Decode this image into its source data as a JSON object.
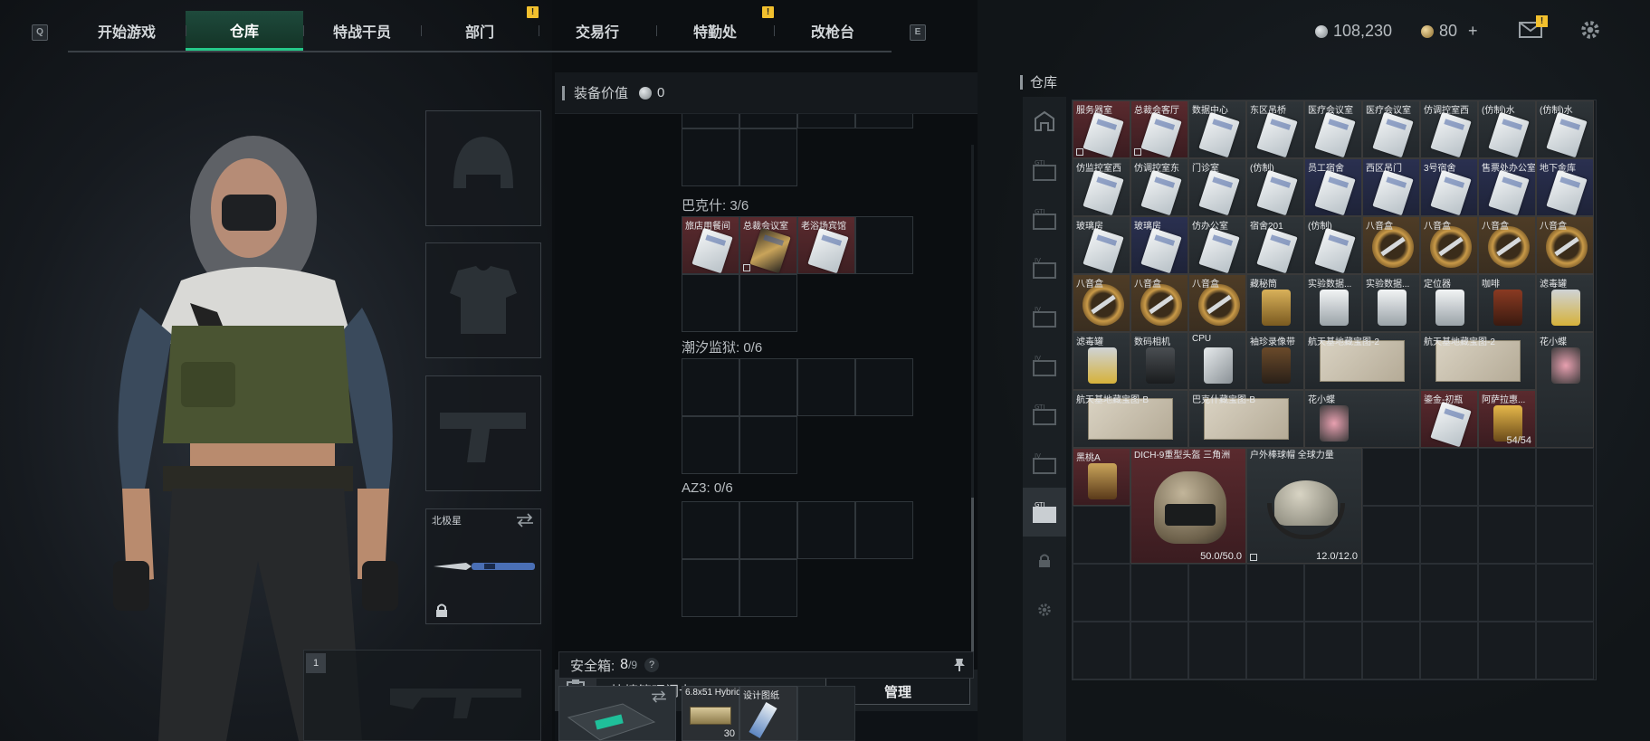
{
  "nav": {
    "q_key": "Q",
    "e_key": "E",
    "tabs": [
      {
        "label": "开始游戏",
        "active": false,
        "alert": false
      },
      {
        "label": "仓库",
        "active": true,
        "alert": false
      },
      {
        "label": "特战干员",
        "active": false,
        "alert": false
      },
      {
        "label": "部门",
        "active": false,
        "alert": true
      },
      {
        "label": "交易行",
        "active": false,
        "alert": false
      },
      {
        "label": "特勤处",
        "active": false,
        "alert": true
      },
      {
        "label": "改枪台",
        "active": false,
        "alert": false
      }
    ],
    "alert_glyph": "!"
  },
  "currency": {
    "silver": "108,230",
    "gold": "80",
    "plus": "+",
    "mail_alert": "!"
  },
  "equipment": {
    "melee_label": "北极星",
    "weapon_slot_number": "1"
  },
  "middle": {
    "value_label": "装备价值",
    "value": "0",
    "sections": [
      {
        "title": "巴克什: 3/6"
      },
      {
        "title": "潮汐监狱: 0/6"
      },
      {
        "title": "AZ3: 0/6"
      }
    ],
    "bakesh_keys": [
      "旅店用餐间",
      "总裁会议室",
      "老浴场宾馆"
    ],
    "quick_manage_label": "快捷管理门卡",
    "manage_button": "管理",
    "safe_box_label": "安全箱:",
    "safe_box_count": "8",
    "safe_box_max": "/9",
    "safe_help": "?",
    "safe_items": [
      {
        "label": "6.8x51 Hybrid",
        "count": "30"
      },
      {
        "label": "设计图纸",
        "count": ""
      }
    ]
  },
  "warehouse": {
    "title": "仓库",
    "items": [
      {
        "label": "服务器室",
        "style": "red"
      },
      {
        "label": "总裁会客厅",
        "style": "red"
      },
      {
        "label": "数据中心",
        "style": "dark"
      },
      {
        "label": "东区吊桥",
        "style": "dark"
      },
      {
        "label": "医疗会议室",
        "style": "dark"
      },
      {
        "label": "医疗会议室",
        "style": "dark"
      },
      {
        "label": "仿调控室西",
        "style": "dark"
      },
      {
        "label": "(仿制)水",
        "style": "dark"
      },
      {
        "label": "(仿制)水",
        "style": "dark"
      },
      {
        "label": "仿监控室西",
        "style": "dark"
      },
      {
        "label": "仿调控室东",
        "style": "dark"
      },
      {
        "label": "门诊室",
        "style": "dark"
      },
      {
        "label": "(仿制)",
        "style": "dark"
      },
      {
        "label": "员工宿舍",
        "style": "blue"
      },
      {
        "label": "西区吊门",
        "style": "blue"
      },
      {
        "label": "3号宿舍",
        "style": "blue"
      },
      {
        "label": "售票处办公室",
        "style": "blue"
      },
      {
        "label": "地下金库",
        "style": "blue"
      },
      {
        "label": "玻璃房",
        "style": "dark"
      },
      {
        "label": "玻璃房",
        "style": "blue"
      },
      {
        "label": "仿办公室",
        "style": "dark"
      },
      {
        "label": "宿舍201",
        "style": "dark"
      },
      {
        "label": "(仿制)",
        "style": "dark"
      },
      {
        "label": "八音盒",
        "style": "gold"
      },
      {
        "label": "八音盒",
        "style": "gold"
      },
      {
        "label": "八音盒",
        "style": "gold"
      },
      {
        "label": "八音盒",
        "style": "gold"
      },
      {
        "label": "八音盒",
        "style": "gold"
      },
      {
        "label": "八音盒",
        "style": "gold"
      },
      {
        "label": "八音盒",
        "style": "gold"
      },
      {
        "label": "藏秘筒",
        "style": "dark"
      },
      {
        "label": "实验数据...",
        "style": "dark"
      },
      {
        "label": "实验数据...",
        "style": "dark"
      },
      {
        "label": "定位器",
        "style": "dark"
      },
      {
        "label": "咖啡",
        "style": "dark"
      },
      {
        "label": "滤毒罐",
        "style": "dark"
      },
      {
        "label": "滤毒罐",
        "style": "dark"
      },
      {
        "label": "数码相机",
        "style": "dark"
      },
      {
        "label": "CPU",
        "style": "dark"
      },
      {
        "label": "袖珍录像带",
        "style": "dark"
      },
      {
        "label": "航天基地藏宝图-2",
        "style": "dark"
      },
      {
        "label": "航天基地藏宝图-2",
        "style": "dark"
      },
      {
        "label": "花小蝶",
        "style": "dark"
      },
      {
        "label": "航天基地藏宝图-B",
        "style": "dark"
      },
      {
        "label": "巴克什藏宝图-B",
        "style": "dark"
      },
      {
        "label": "花小蝶",
        "style": "dark"
      },
      {
        "label": "鎏金-初瓶",
        "style": "red"
      },
      {
        "label": "阿萨拉惠...",
        "style": "red"
      },
      {
        "label": "黑桃A",
        "style": "red"
      },
      {
        "label": "DICH-9重型头盔 三角洲",
        "style": "red"
      },
      {
        "label": "户外棒球帽 全球力量",
        "style": "dark"
      }
    ],
    "stack_count": "54/54",
    "helmet_durability": "50.0/50.0",
    "cap_durability": "12.0/12.0"
  },
  "colors": {
    "accent": "#25c98a",
    "alert": "#f2c02e",
    "rare_red": "#5a2a2e",
    "gold_item": "#c99a48"
  }
}
